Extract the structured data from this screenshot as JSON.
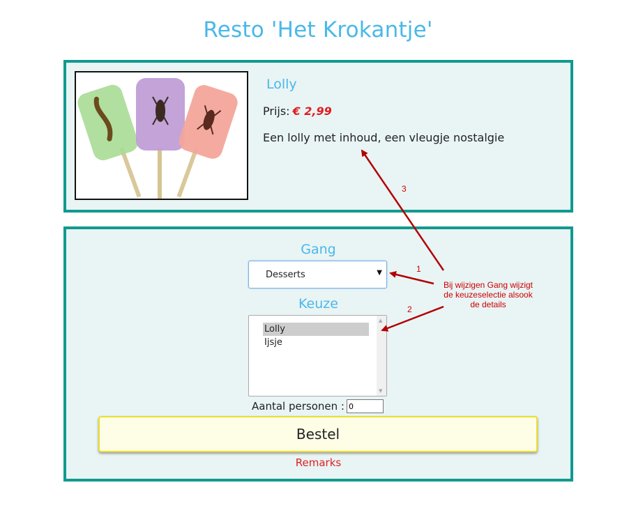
{
  "page": {
    "title": "Resto 'Het Krokantje'"
  },
  "product": {
    "name": "Lolly",
    "price_label": "Prijs:",
    "price_value": "€ 2,99",
    "description": "Een lolly met inhoud, een vleugje nostalgie"
  },
  "order": {
    "gang_label": "Gang",
    "gang_selected": "Desserts",
    "keuze_label": "Keuze",
    "keuze_items": [
      "Lolly",
      "Ijsje"
    ],
    "keuze_selected_index": 0,
    "persons_label": "Aantal personen :",
    "persons_value": "0",
    "order_button": "Bestel",
    "remarks": "Remarks"
  },
  "annotations": {
    "num1": "1",
    "num2": "2",
    "num3": "3",
    "note_lines": [
      "Bij wijzigen Gang wijzigt",
      "de keuzeselectie alsook",
      "de details"
    ],
    "color": "#cc0000"
  },
  "colors": {
    "accent": "#4ab8e8",
    "panel_border": "#0f9b8e",
    "panel_bg": "#e9f4f5",
    "price": "#e01c1c",
    "button_border": "#ebe02a",
    "remarks": "#e02020"
  }
}
